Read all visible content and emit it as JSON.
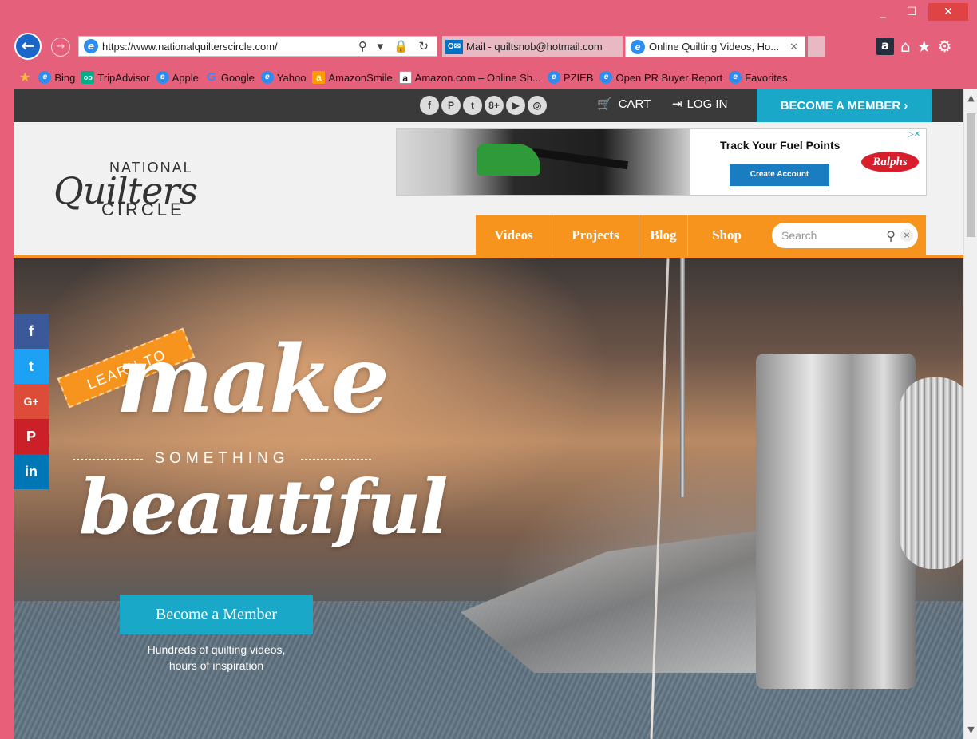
{
  "window": {
    "minimize": "_",
    "maximize": "☐",
    "close": "✕"
  },
  "browser": {
    "back": "←",
    "forward": "→",
    "url": "https://www.nationalquilterscircle.com/",
    "address_tools": "⚲ ▾ 🔒 ↻",
    "tabs": [
      {
        "label": "Mail - quiltsnob@hotmail.com",
        "icon": "outlook-icon"
      },
      {
        "label": "Online Quilting Videos, Ho...",
        "icon": "ie-icon",
        "close": "✕"
      }
    ],
    "right_tools": {
      "amazon": "a",
      "home": "⌂",
      "favorites": "★",
      "settings": "⚙"
    }
  },
  "favorites": [
    {
      "label": "Bing",
      "icon": "ie"
    },
    {
      "label": "TripAdvisor",
      "icon": "tripadvisor"
    },
    {
      "label": "Apple",
      "icon": "ie"
    },
    {
      "label": "Google",
      "icon": "google"
    },
    {
      "label": "Yahoo",
      "icon": "ie"
    },
    {
      "label": "AmazonSmile",
      "icon": "amazon"
    },
    {
      "label": "Amazon.com – Online Sh...",
      "icon": "amazon"
    },
    {
      "label": "PZIEB",
      "icon": "ie"
    },
    {
      "label": "Open PR Buyer Report",
      "icon": "ie"
    },
    {
      "label": "Favorites",
      "icon": "ie"
    }
  ],
  "site": {
    "social_top": [
      "f",
      "P",
      "t",
      "8+",
      "▶",
      "◎"
    ],
    "cart": "CART",
    "login": "LOG IN",
    "become_member_top": "BECOME A MEMBER ›",
    "logo": {
      "national": "NATIONAL",
      "quilters": "Quilters",
      "circle": "CIRCLE"
    },
    "ad": {
      "headline": "Track Your Fuel Points",
      "cta": "Create Account",
      "brand": "Ralphs",
      "choices": "▷✕"
    },
    "nav": {
      "videos": "Videos",
      "projects": "Projects",
      "blog": "Blog",
      "shop": "Shop"
    },
    "search": {
      "placeholder": "Search",
      "clear": "×"
    },
    "share": {
      "facebook": "f",
      "twitter": "t",
      "googleplus": "G+",
      "pinterest": "P",
      "linkedin": "in"
    },
    "hero": {
      "ribbon": "LEARN TO",
      "make": "make",
      "something": "SOMETHING",
      "beautiful": "beautiful",
      "cta": "Become a Member",
      "sub_line1": "Hundreds of quilting videos,",
      "sub_line2": "hours of inspiration"
    }
  },
  "colors": {
    "chrome": "#e4607b",
    "accent_orange": "#f7941d",
    "accent_teal": "#1aa8c9",
    "topbar": "#3a3a3a"
  }
}
